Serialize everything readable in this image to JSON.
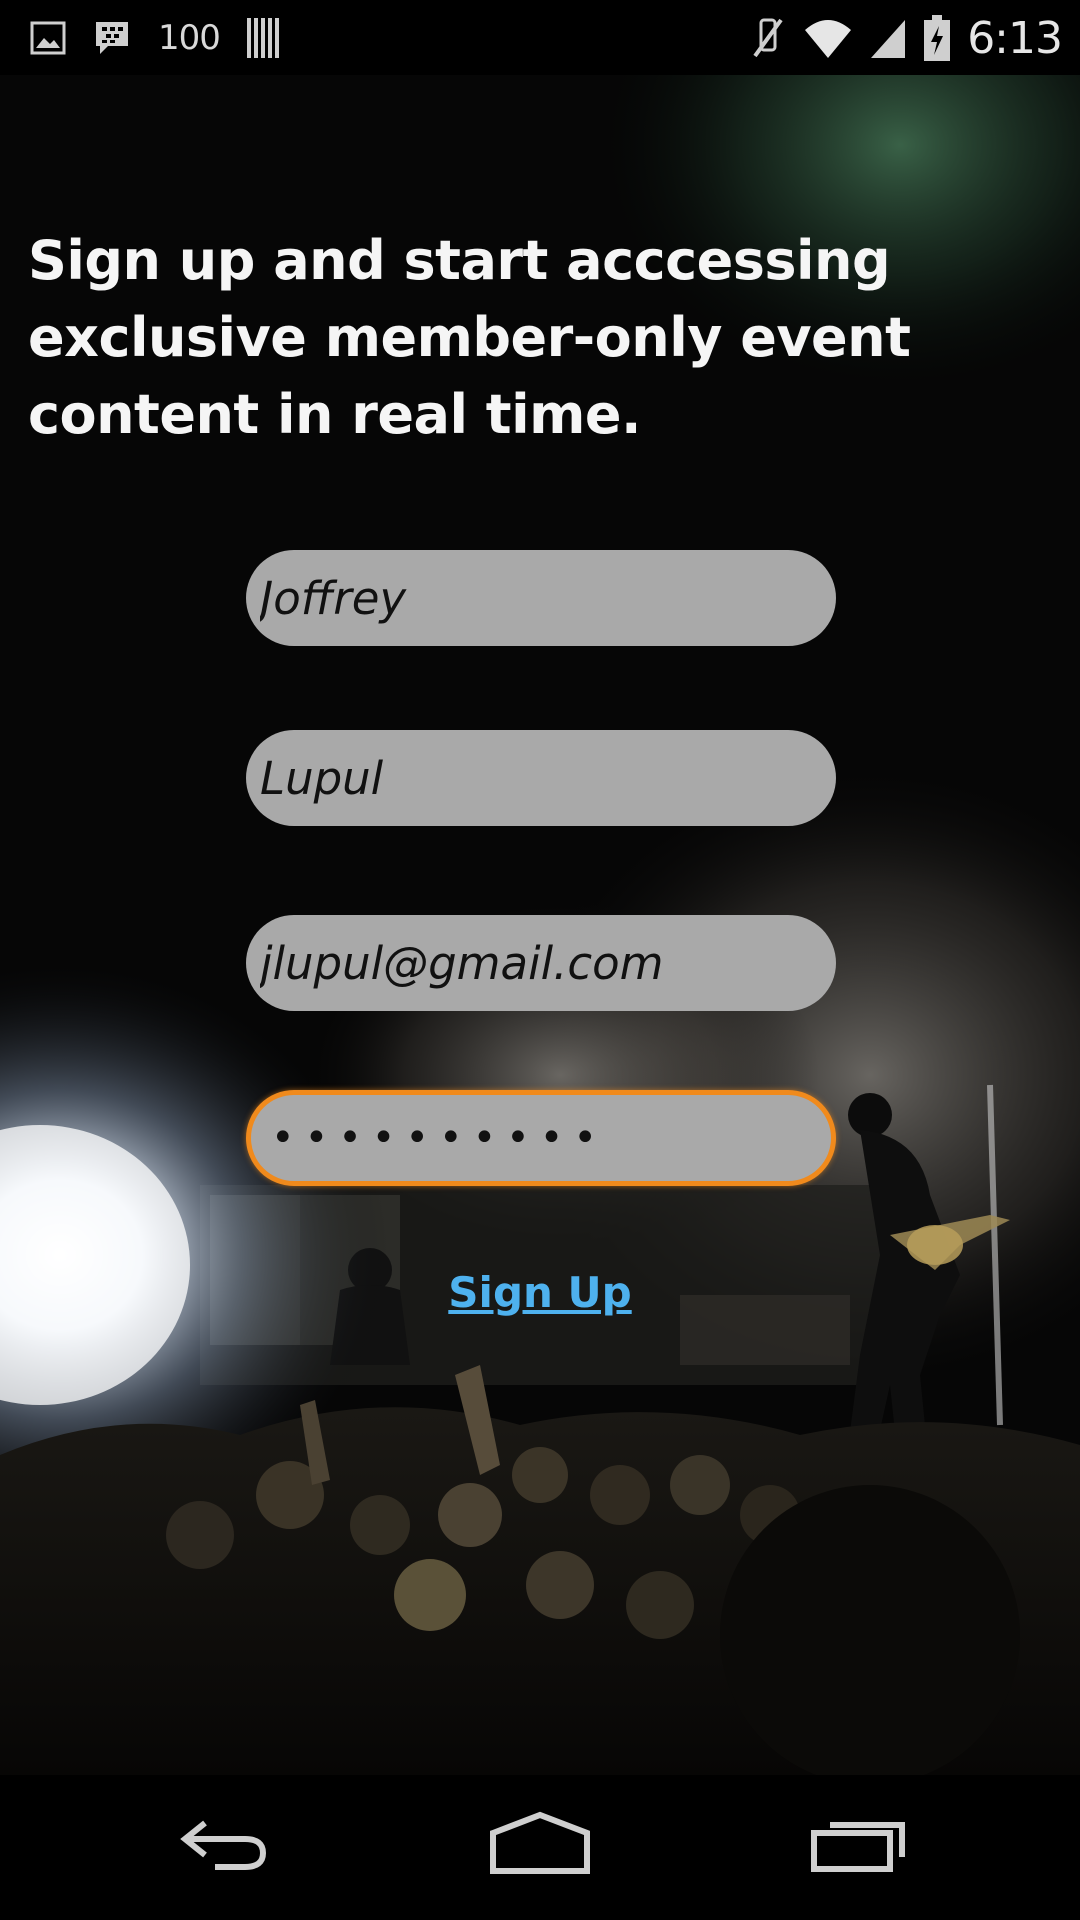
{
  "status_bar": {
    "left_icons": [
      "gallery-icon",
      "bbm-icon",
      "counter-text",
      "barcode-icon"
    ],
    "counter_text": "100",
    "right_icons": [
      "mute-icon",
      "wifi-icon",
      "signal-icon",
      "battery-icon"
    ],
    "time": "6:13"
  },
  "signup_form": {
    "headline": "Sign up and start acccessing exclusive member-only event content in real time.",
    "first_name_value": "Joffrey",
    "last_name_value": "Lupul",
    "email_value": "jlupul@gmail.com",
    "password_masked": "••••••••••",
    "signup_label": "Sign Up"
  },
  "colors": {
    "focused_field_border": "#f08a1c",
    "link_color": "#4eb1ee",
    "field_background": "#a9a9a9"
  },
  "nav_bar": {
    "icons": [
      "back-icon",
      "home-icon",
      "recent-apps-icon"
    ]
  }
}
